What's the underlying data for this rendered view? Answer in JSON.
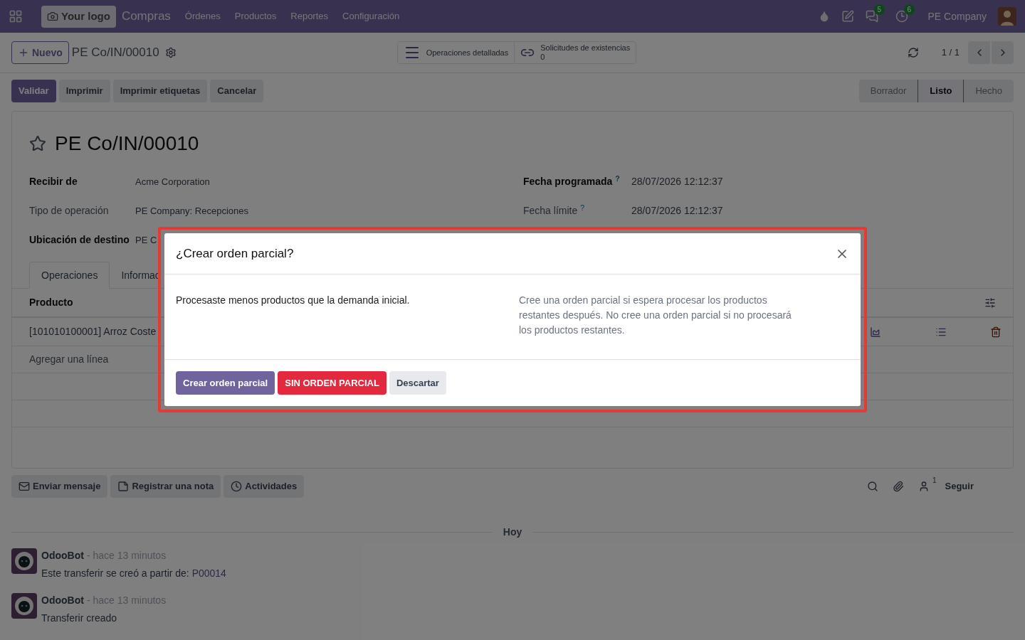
{
  "navbar": {
    "logo_label": "Your logo",
    "app_name": "Compras",
    "menu": [
      "Órdenes",
      "Productos",
      "Reportes",
      "Configuración"
    ],
    "messages_count": "5",
    "activities_count": "6",
    "company": "PE Company"
  },
  "control_panel": {
    "new_button": "Nuevo",
    "breadcrumb": "PE Co/IN/00010",
    "smart_buttons": [
      {
        "kind": "list",
        "label": "Operaciones detalladas"
      },
      {
        "kind": "link",
        "label": "Solicitudes de existencias",
        "value": "0"
      }
    ],
    "pager": "1 / 1"
  },
  "actions": [
    {
      "label": "Validar",
      "primary": true
    },
    {
      "label": "Imprimir",
      "primary": false
    },
    {
      "label": "Imprimir etiquetas",
      "primary": false
    },
    {
      "label": "Cancelar",
      "primary": false
    }
  ],
  "statusbar": [
    {
      "label": "Borrador",
      "selected": false
    },
    {
      "label": "Listo",
      "selected": true
    },
    {
      "label": "Hecho",
      "selected": false
    }
  ],
  "record": {
    "title": "PE Co/IN/00010",
    "starred": false,
    "fields_left": [
      {
        "label": "Recibir de",
        "value": "Acme Corporation",
        "required": true
      },
      {
        "label": "Tipo de operación",
        "value": "PE Company: Recepciones",
        "required": false
      },
      {
        "label": "Ubicación de destino",
        "value": "PE C",
        "required": true
      }
    ],
    "fields_right": [
      {
        "label": "Fecha programada",
        "help": "?",
        "value": "28/07/2026 12:12:37",
        "required": true
      },
      {
        "label": "Fecha límite",
        "help": "?",
        "value": "28/07/2026 12:12:37",
        "required": false
      }
    ]
  },
  "tabs": [
    {
      "label": "Operaciones",
      "selected": true
    },
    {
      "label": "Informac",
      "selected": false
    }
  ],
  "lines": {
    "columns": [
      "Producto"
    ],
    "rows": [
      {
        "product": "[101010100001] Arroz Coste"
      }
    ],
    "add_line": "Agregar una línea"
  },
  "chatter": {
    "buttons": [
      {
        "kind": "mail",
        "label": "Enviar mensaje"
      },
      {
        "kind": "note",
        "label": "Registrar una nota"
      },
      {
        "kind": "clock",
        "label": "Actividades"
      }
    ],
    "followers_count": "1",
    "follow": "Seguir",
    "date_separator": "Hoy",
    "messages": [
      {
        "author": "OdooBot",
        "time": "- hace 13 minutos",
        "body": "Este transferir se creó a partir de: ",
        "link": "P00014"
      },
      {
        "author": "OdooBot",
        "time": "- hace 13 minutos",
        "body": "Transferir creado"
      }
    ]
  },
  "dialog": {
    "title": "¿Crear orden parcial?",
    "text_left": "Procesaste menos productos que la demanda inicial.",
    "text_right": "Cree una orden parcial si espera procesar los productos restantes después. No cree una orden parcial si no procesará los productos restantes.",
    "highlighted": true,
    "buttons": [
      {
        "label": "Crear orden parcial",
        "kind": "primary"
      },
      {
        "label": "SIN ORDEN PARCIAL",
        "kind": "danger"
      },
      {
        "label": "Descartar",
        "kind": "secondary"
      }
    ]
  }
}
